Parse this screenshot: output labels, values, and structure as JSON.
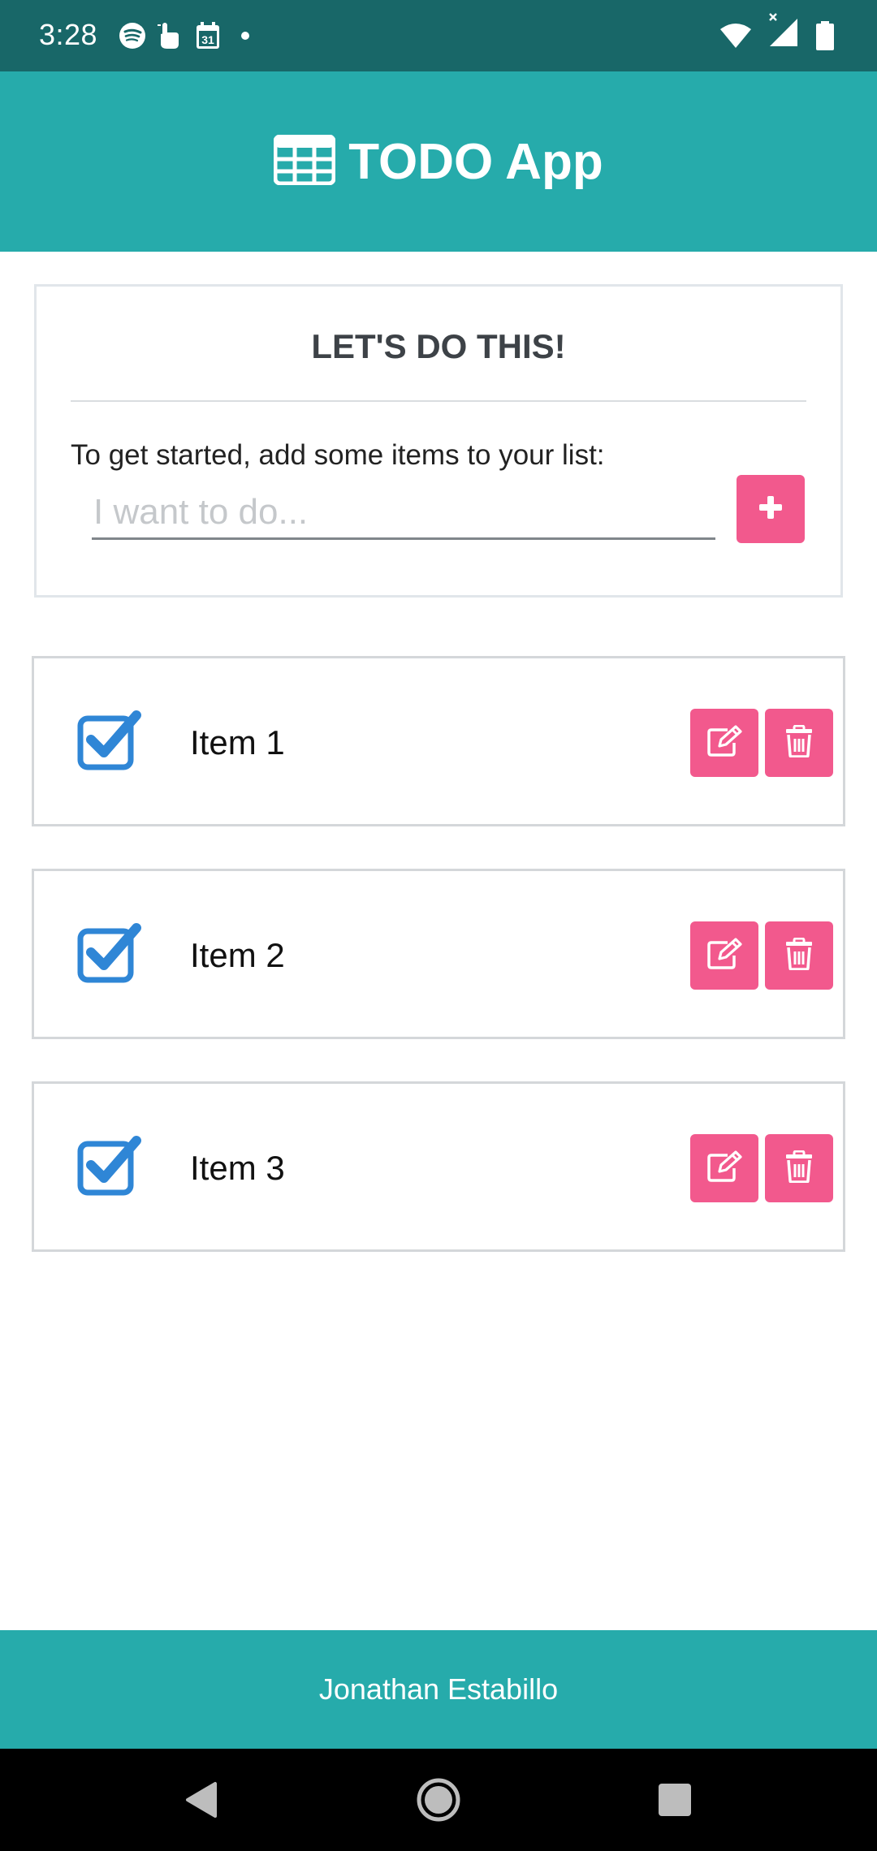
{
  "status_bar": {
    "time": "3:28",
    "left_icons": [
      "spotify-icon",
      "touch-icon",
      "calendar-icon",
      "dot-icon"
    ],
    "calendar_day": "31",
    "right_icons": [
      "wifi-icon",
      "signal-icon",
      "battery-icon"
    ]
  },
  "header": {
    "icon": "table-icon",
    "title": "TODO App"
  },
  "intro": {
    "heading": "LET'S DO THIS!",
    "prompt": "To get started, add some items to your list:",
    "input_placeholder": "I want to do...",
    "input_value": "",
    "add_button_icon": "plus-icon"
  },
  "todos": [
    {
      "label": "Item 1",
      "checked": true
    },
    {
      "label": "Item 2",
      "checked": true
    },
    {
      "label": "Item 3",
      "checked": true
    }
  ],
  "footer": {
    "text": "Jonathan Estabillo"
  },
  "nav_bar": {
    "buttons": [
      "back-icon",
      "home-icon",
      "recents-icon"
    ]
  },
  "colors": {
    "status_bar": "#186768",
    "primary": "#26abab",
    "accent": "#f2598d",
    "checkbox": "#2f86d6",
    "heading_text": "#3d4247"
  }
}
